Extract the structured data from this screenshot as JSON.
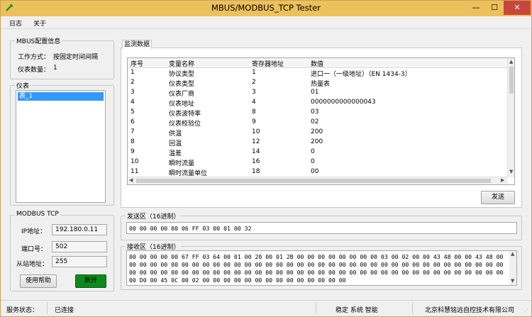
{
  "window": {
    "title": "MBUS/MODBUS_TCP Tester",
    "close_label": "✕",
    "min_label": "—",
    "max_label": "☐"
  },
  "menu": {
    "items": [
      "日志",
      "关于"
    ]
  },
  "mbus_config": {
    "title": "MBUS配置信息",
    "mode_label": "工作方式：",
    "mode_value": "按固定时间间隔",
    "count_label": "仪表数量：",
    "count_value": "1"
  },
  "meters": {
    "title": "仪表",
    "items": [
      "表_1"
    ]
  },
  "modbus": {
    "title": "MODBUS TCP",
    "ip_label": "IP地址：",
    "ip_value": "192.180.0.11",
    "port_label": "端口号：",
    "port_value": "502",
    "slave_label": "从站地址：",
    "slave_value": "255",
    "help_button": "使用帮助",
    "disconnect_button": "断开"
  },
  "monitor": {
    "tab_label": "监测数据",
    "columns": [
      "序号",
      "变量名称",
      "寄存器地址",
      "数值"
    ],
    "rows": [
      [
        "1",
        "协议类型",
        "1",
        "进口一（一级地址）（EN 1434-3）"
      ],
      [
        "2",
        "仪表类型",
        "2",
        "热量表"
      ],
      [
        "3",
        "仪表厂商",
        "3",
        "01"
      ],
      [
        "4",
        "仪表地址",
        "4",
        "0000000000000043"
      ],
      [
        "5",
        "仪表波特率",
        "8",
        "03"
      ],
      [
        "6",
        "仪表校验位",
        "9",
        "02"
      ],
      [
        "7",
        "供温",
        "10",
        "200"
      ],
      [
        "8",
        "回温",
        "12",
        "200"
      ],
      [
        "9",
        "温差",
        "14",
        "0"
      ],
      [
        "10",
        "瞬时流量",
        "16",
        "0"
      ],
      [
        "11",
        "瞬时流量单位",
        "18",
        "00"
      ]
    ],
    "send_button": "发送"
  },
  "send_area": {
    "title": "发送区（16进制）",
    "value": "00 00 00 00 00 06 FF 03 00 01 00 32"
  },
  "receive_area": {
    "title": "接收区（16进制）",
    "value": "00 00 00 00 00 67 FF 03 64 00 01 00 20 00 01 2B 00 00 00 00 00 00 00 00 03 00 02 00 00 43 48 00 00 43 48 00 00 00 00 00 00 00 00 00 00 00 00 00 00 00 00 00 00 00 00 00 00 00 00 00 00 00 00 00 00 00 00 00 00 00 00 00 00 00 00 00 00 00 00 00 00 00 00 00 00 00 00 00 00 00 00 00 00 00 00 00 00 00 00 00 00 00 00 00 00 00 00 00 00 D0 00 45 0C 00 02 00 00 00 00 00 00 00 00 00 00 00 00 00 00"
  },
  "status": {
    "service_label": "服务状态：",
    "service_value": "已连接",
    "slogan": "稳定 系统 智能",
    "company": "北京科慧铭远自控技术有限公司"
  },
  "colors": {
    "titlebar": "#ecc05b",
    "close": "#c7473c",
    "green_button": "#0e8a1c",
    "selection": "#3399ff"
  }
}
